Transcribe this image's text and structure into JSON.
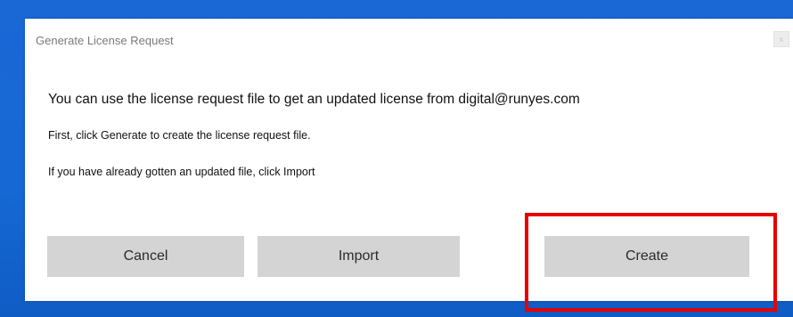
{
  "dialog": {
    "title": "Generate License Request",
    "close_label": "x",
    "message_main": "You can use the license request file to get an updated license from digital@runyes.com",
    "message_step1": "First, click Generate to create the license request file.",
    "message_step2": "If you have already gotten an updated file, click Import",
    "buttons": {
      "cancel": "Cancel",
      "import": "Import",
      "create": "Create"
    }
  },
  "colors": {
    "desktop_background": "#1668d4",
    "highlight": "#e60000",
    "button_background": "#d4d4d4"
  }
}
